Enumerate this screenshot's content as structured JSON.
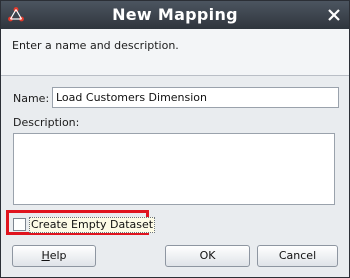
{
  "window": {
    "title": "New Mapping",
    "icon": "app-logo-icon",
    "close_icon": "close-icon"
  },
  "header": {
    "instruction": "Enter a name and description."
  },
  "form": {
    "name_label": "Name:",
    "name_value": "Load Customers Dimension",
    "description_label": "Description:",
    "description_value": ""
  },
  "options": {
    "create_empty_dataset_label": "Create Empty Dataset",
    "create_empty_dataset_checked": false
  },
  "buttons": {
    "help_first": "H",
    "help_rest": "elp",
    "ok": "OK",
    "cancel": "Cancel"
  },
  "colors": {
    "highlight": "#e0141e",
    "titlebar": "#3a414a"
  }
}
